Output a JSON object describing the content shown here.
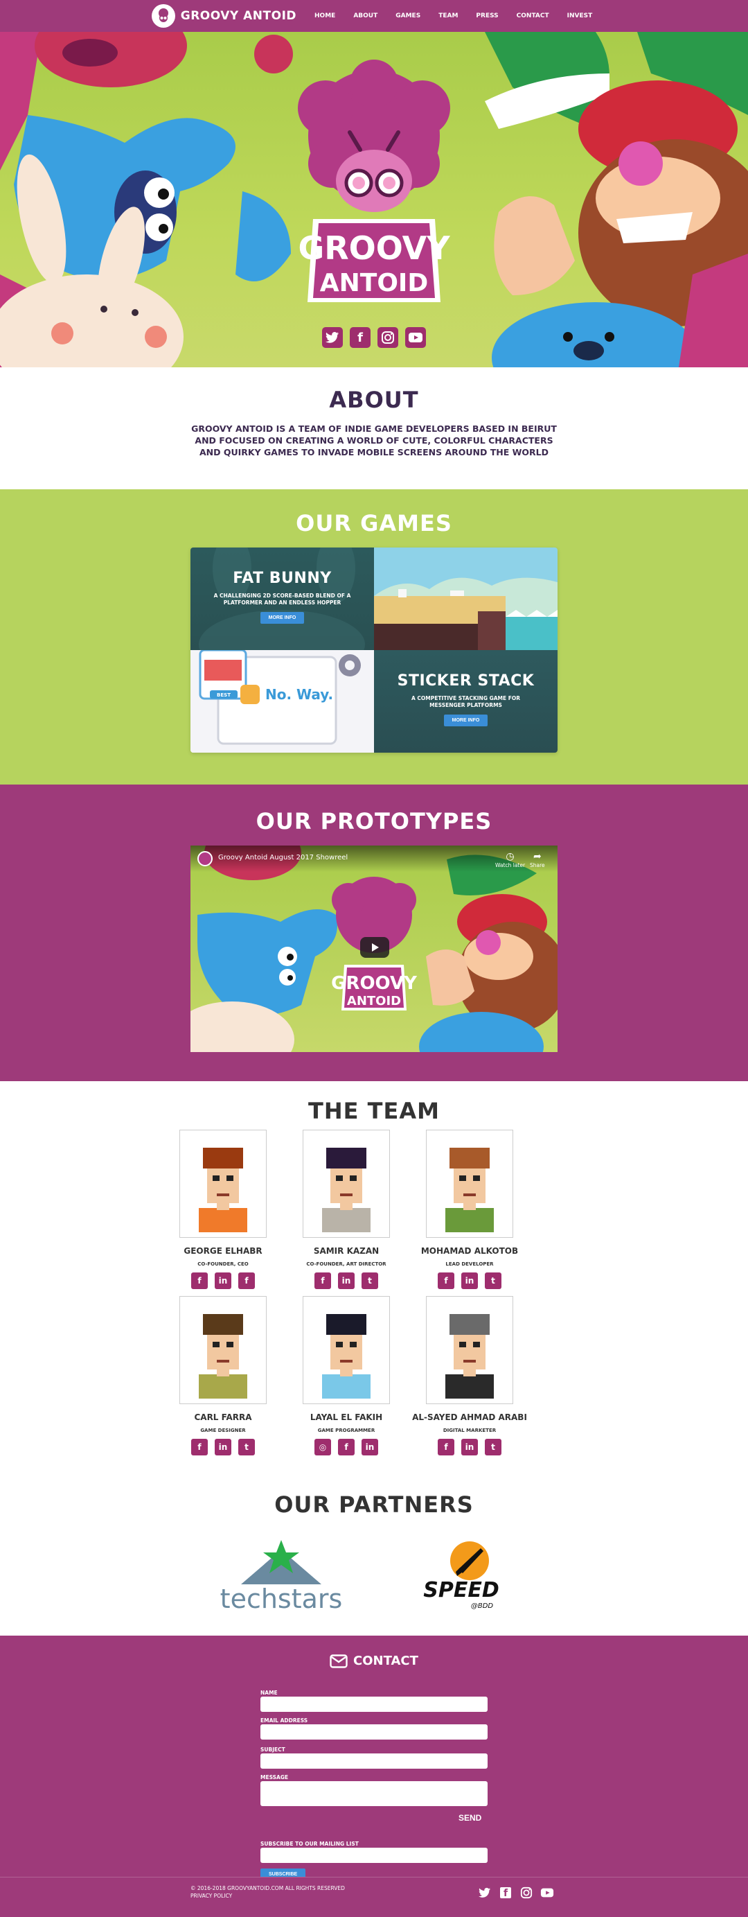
{
  "nav": {
    "logo_text": "GROOVY ANTOID",
    "links": [
      "HOME",
      "ABOUT",
      "GAMES",
      "TEAM",
      "PRESS",
      "CONTACT",
      "INVEST"
    ]
  },
  "hero": {
    "logo_line1": "GROOVY",
    "logo_line2": "ANTOID",
    "social_icons": [
      "twitter-icon",
      "facebook-icon",
      "instagram-icon",
      "youtube-icon"
    ]
  },
  "about": {
    "title": "ABOUT",
    "text": "GROOVY ANTOID IS A TEAM OF INDIE GAME DEVELOPERS BASED IN BEIRUT AND FOCUSED ON CREATING A WORLD OF CUTE, COLORFUL CHARACTERS AND QUIRKY GAMES TO INVADE MOBILE SCREENS AROUND THE WORLD"
  },
  "games": {
    "title": "OUR GAMES",
    "items": [
      {
        "title": "FAT BUNNY",
        "desc": "A CHALLENGING 2D SCORE-BASED BLEND OF A PLATFORMER AND AN ENDLESS HOPPER",
        "button": "MORE INFO"
      },
      {
        "title": "STICKER STACK",
        "desc": "A COMPETITIVE STACKING GAME FOR MESSENGER PLATFORMS",
        "button": "MORE INFO"
      }
    ],
    "noway_text": "No. Way.",
    "noway_tag": "BEST"
  },
  "prototypes": {
    "title": "OUR PROTOTYPES",
    "video_title": "Groovy Antoid August 2017 Showreel",
    "watch_later": "Watch later",
    "share": "Share",
    "logo_line1": "GROOVY",
    "logo_line2": "ANTOID"
  },
  "team": {
    "title": "THE TEAM",
    "members": [
      {
        "name": "GEORGE ELHABR",
        "role": "CO-FOUNDER, CEO",
        "socials": [
          "facebook-icon",
          "linkedin-icon",
          "facebook-icon"
        ],
        "hair": "#9a3a10",
        "shirt": "#f07a2a"
      },
      {
        "name": "SAMIR KAZAN",
        "role": "CO-FOUNDER, ART DIRECTOR",
        "socials": [
          "facebook-icon",
          "linkedin-icon",
          "twitter-icon"
        ],
        "hair": "#2a1a3a",
        "shirt": "#b9b3a8"
      },
      {
        "name": "MOHAMAD ALKOTOB",
        "role": "LEAD DEVELOPER",
        "socials": [
          "facebook-icon",
          "linkedin-icon",
          "twitter-icon"
        ],
        "hair": "#a85a2a",
        "shirt": "#6a9a3a"
      },
      {
        "name": "CARL FARRA",
        "role": "GAME DESIGNER",
        "socials": [
          "facebook-icon",
          "linkedin-icon",
          "twitter-icon"
        ],
        "hair": "#5a3a1a",
        "shirt": "#a8a84a"
      },
      {
        "name": "LAYAL EL FAKIH",
        "role": "GAME PROGRAMMER",
        "socials": [
          "instagram-icon",
          "facebook-icon",
          "linkedin-icon"
        ],
        "hair": "#1a1a2a",
        "shirt": "#7ac8e8"
      },
      {
        "name": "AL-SAYED AHMAD ARABI",
        "role": "DIGITAL MARKETER",
        "socials": [
          "facebook-icon",
          "linkedin-icon",
          "twitter-icon"
        ],
        "hair": "#6a6a6a",
        "shirt": "#2a2a2a"
      }
    ]
  },
  "partners": {
    "title": "OUR PARTNERS",
    "techstars": "techstars",
    "speed": "SPEED",
    "speed_sub": "@BDD"
  },
  "contact": {
    "title": "CONTACT",
    "labels": {
      "name": "NAME",
      "email": "EMAIL ADDRESS",
      "subject": "SUBJECT",
      "message": "MESSAGE",
      "subscribe": "SUBSCRIBE TO OUR MAILING LIST"
    },
    "send": "SEND",
    "subscribe_button": "SUBSCRIBE"
  },
  "footer": {
    "copyright": "© 2016-2018 GROOVYANTOID.COM ALL RIGHTS RESERVED",
    "privacy": "PRIVACY POLICY",
    "social_icons": [
      "twitter-icon",
      "facebook-icon",
      "instagram-icon",
      "youtube-icon"
    ]
  },
  "colors": {
    "brand": "#9e3a7a",
    "green": "#b6d35e",
    "button_blue": "#3a8ed8",
    "dark_teal": "#2f5c5e"
  }
}
